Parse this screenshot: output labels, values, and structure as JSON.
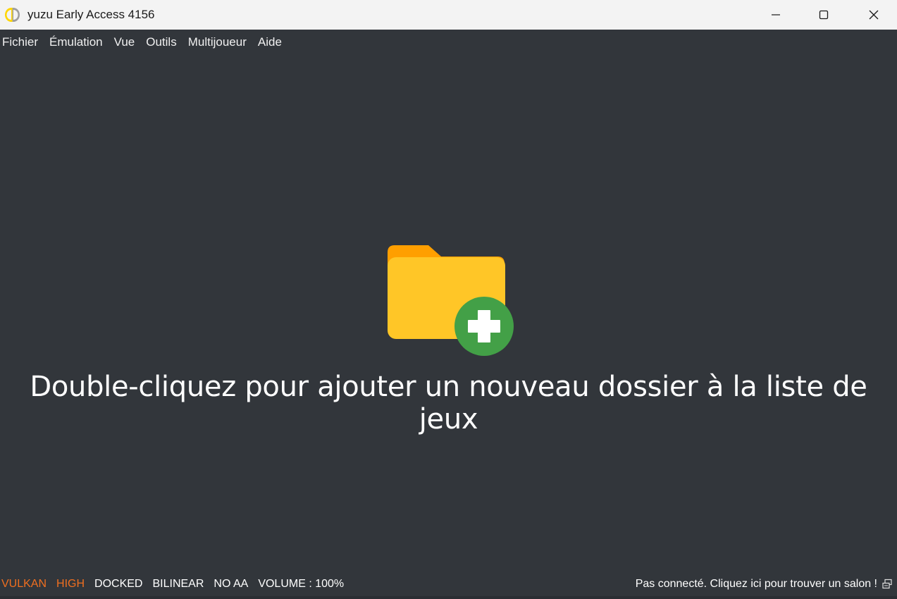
{
  "window": {
    "title": "yuzu Early Access 4156"
  },
  "menu": {
    "items": [
      "Fichier",
      "Émulation",
      "Vue",
      "Outils",
      "Multijoueur",
      "Aide"
    ]
  },
  "main": {
    "placeholder": "Double-cliquez pour ajouter un nouveau dossier à la liste de jeux",
    "icon": "folder-add-icon"
  },
  "status": {
    "api": "VULKAN",
    "accuracy": "HIGH",
    "dock_mode": "DOCKED",
    "filter": "BILINEAR",
    "aa": "NO AA",
    "volume": "VOLUME : 100%",
    "network": "Pas connecté. Cliquez ici pour trouver un salon !"
  },
  "colors": {
    "background": "#32363b",
    "status_accent": "#f06f20",
    "folder_front": "#ffc627",
    "folder_back": "#ff9f00",
    "plus_circle": "#43a047"
  }
}
